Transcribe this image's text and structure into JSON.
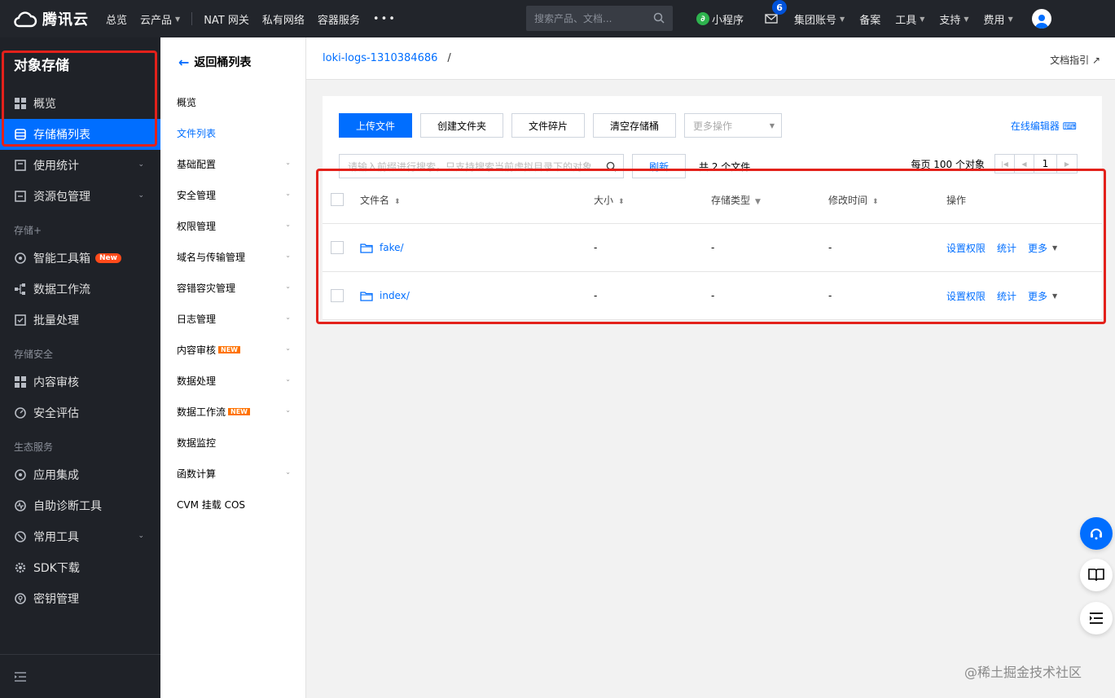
{
  "topbar": {
    "brand": "腾讯云",
    "nav": [
      "总览",
      "云产品",
      "NAT 网关",
      "私有网络",
      "容器服务"
    ],
    "search_placeholder": "搜索产品、文档...",
    "miniapp": "小程序",
    "mail_count": "6",
    "right": [
      "集团账号",
      "备案",
      "工具",
      "支持",
      "费用"
    ]
  },
  "sidebar": {
    "title": "对象存储",
    "items": [
      {
        "label": "概览",
        "icon": "grid-icon"
      },
      {
        "label": "存储桶列表",
        "icon": "bucket-icon"
      },
      {
        "label": "使用统计",
        "icon": "stats-icon"
      },
      {
        "label": "资源包管理",
        "icon": "package-icon"
      }
    ],
    "group1": "存储+",
    "group1_items": [
      {
        "label": "智能工具箱",
        "badge": "New"
      },
      {
        "label": "数据工作流"
      },
      {
        "label": "批量处理"
      }
    ],
    "group2": "存储安全",
    "group2_items": [
      {
        "label": "内容审核"
      },
      {
        "label": "安全评估"
      }
    ],
    "group3": "生态服务",
    "group3_items": [
      {
        "label": "应用集成"
      },
      {
        "label": "自助诊断工具"
      },
      {
        "label": "常用工具"
      },
      {
        "label": "SDK下载"
      },
      {
        "label": "密钥管理"
      }
    ]
  },
  "subnav": {
    "back": "返回桶列表",
    "items": [
      "概览",
      "文件列表",
      "基础配置",
      "安全管理",
      "权限管理",
      "域名与传输管理",
      "容错容灾管理",
      "日志管理",
      "内容审核",
      "数据处理",
      "数据工作流",
      "数据监控",
      "函数计算",
      "CVM 挂载 COS"
    ],
    "new_tag": "NEW"
  },
  "header": {
    "bucket": "loki-logs-1310384686",
    "slash": "/",
    "doc": "文档指引"
  },
  "toolbar": {
    "upload": "上传文件",
    "mkdir": "创建文件夹",
    "fragments": "文件碎片",
    "clear": "清空存储桶",
    "more": "更多操作",
    "editor": "在线编辑器"
  },
  "search": {
    "placeholder": "请输入前缀进行搜索，只支持搜索当前虚拟目录下的对象",
    "refresh": "刷新",
    "count": "共 2 个文件",
    "per_page": "每页 100 个对象",
    "page": "1"
  },
  "table": {
    "headers": [
      "文件名",
      "大小",
      "存储类型",
      "修改时间",
      "操作"
    ],
    "rows": [
      {
        "name": "fake/",
        "size": "-",
        "type": "-",
        "time": "-"
      },
      {
        "name": "index/",
        "size": "-",
        "type": "-",
        "time": "-"
      }
    ],
    "ops": [
      "设置权限",
      "统计",
      "更多"
    ]
  },
  "watermark": "@稀土掘金技术社区",
  "colors": {
    "accent": "#006eff",
    "highlight": "#e3211b",
    "topbar": "#22252b",
    "sidebar": "#1f2228"
  }
}
